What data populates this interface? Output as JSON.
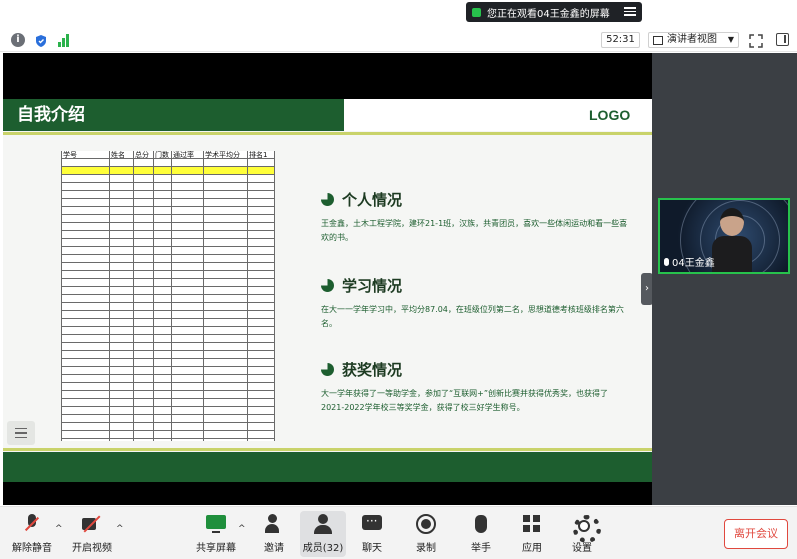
{
  "share_banner": {
    "text": "您正在观看04王金鑫的屏幕"
  },
  "topbar": {
    "timer": "52:31",
    "presenter_view_label": "演讲者视图"
  },
  "slide": {
    "title": "自我介绍",
    "logo": "LOGO",
    "table_headers": [
      "学号",
      "姓名",
      "总分",
      "门数",
      "通过率",
      "学术平均分",
      "排名1"
    ],
    "sections": [
      {
        "heading": "个人情况",
        "body": "王金鑫，土木工程学院，建环21-1班，汉族，共青团员，喜欢一些体闲运动和看一些喜欢的书。"
      },
      {
        "heading": "学习情况",
        "body": "在大一一学年学习中，平均分87.04，在班级位列第二名，思想道德考核班级排名第六名。"
      },
      {
        "heading": "获奖情况",
        "body": "大一学年获得了一等助学金，参加了“互联网+”创新比赛并获得优秀奖，也获得了2021-2022学年校三等奖学金，获得了校三好学生称号。"
      }
    ]
  },
  "video_tile": {
    "name": "04王金鑫"
  },
  "bottombar": {
    "buttons": [
      {
        "key": "unmute",
        "label": "解除静音"
      },
      {
        "key": "video",
        "label": "开启视频"
      },
      {
        "key": "share",
        "label": "共享屏幕"
      },
      {
        "key": "invite",
        "label": "邀请"
      },
      {
        "key": "members",
        "label": "成员(32)"
      },
      {
        "key": "chat",
        "label": "聊天"
      },
      {
        "key": "record",
        "label": "录制"
      },
      {
        "key": "raise_hand",
        "label": "举手"
      },
      {
        "key": "apps",
        "label": "应用"
      },
      {
        "key": "settings",
        "label": "设置"
      }
    ],
    "leave_label": "离开会议"
  },
  "colors": {
    "slide_green": "#1d5e2f",
    "slide_accent": "#c9d36a",
    "leave_red": "#e0483e",
    "speaking_green": "#27c24c"
  }
}
